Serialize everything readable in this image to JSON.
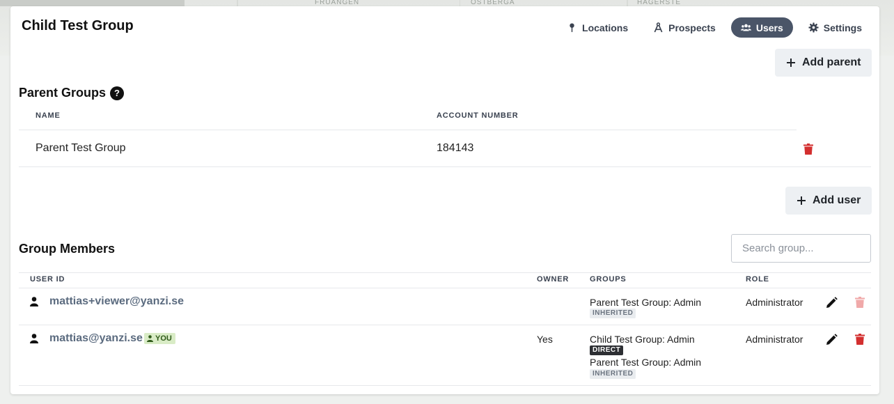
{
  "map": {
    "labels": [
      "FRUÄNGEN",
      "ÖSTBERGA",
      "HÄGERSTE"
    ]
  },
  "header": {
    "title": "Child Test Group",
    "tabs": [
      {
        "label": "Locations",
        "icon": "pin-icon",
        "active": false
      },
      {
        "label": "Prospects",
        "icon": "compass-icon",
        "active": false
      },
      {
        "label": "Users",
        "icon": "users-icon",
        "active": true
      },
      {
        "label": "Settings",
        "icon": "gear-icon",
        "active": false
      }
    ],
    "active_color": "#4a5568"
  },
  "parent_groups": {
    "add_button_label": "Add parent",
    "title": "Parent Groups",
    "help_glyph": "?",
    "columns": [
      "NAME",
      "ACCOUNT NUMBER"
    ],
    "rows": [
      {
        "name": "Parent Test Group",
        "account_number": "184143"
      }
    ]
  },
  "group_members": {
    "add_button_label": "Add user",
    "title": "Group Members",
    "search_placeholder": "Search group...",
    "columns": [
      "USER ID",
      "OWNER",
      "GROUPS",
      "ROLE"
    ],
    "rows": [
      {
        "user_id": "mattias+viewer@yanzi.se",
        "owner": "",
        "groups": [
          {
            "label": "Parent Test Group: Admin",
            "badge": "INHERITED"
          }
        ],
        "role": "Administrator",
        "delete_enabled": false
      },
      {
        "user_id": "mattias@yanzi.se",
        "you_badge": "YOU",
        "owner": "Yes",
        "groups": [
          {
            "label": "Child Test Group: Admin",
            "badge": "DIRECT"
          },
          {
            "label": "Parent Test Group: Admin",
            "badge": "INHERITED"
          }
        ],
        "role": "Administrator",
        "delete_enabled": true
      }
    ]
  },
  "colors": {
    "danger": "#d32f2f",
    "danger_disabled": "#f0a9a9",
    "you_badge_bg": "#d9ecc6"
  }
}
